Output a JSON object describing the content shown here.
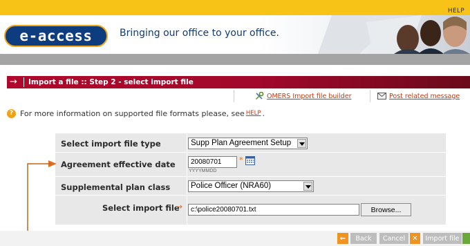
{
  "header": {
    "help_label": "HELP",
    "logo_text": "e-access",
    "tagline": "Bringing our office to your office."
  },
  "section": {
    "arrow": "→",
    "title": "Import a file :: Step 2 - select import file"
  },
  "links": {
    "builder": "OMERS Import file builder",
    "post_message": "Post related message"
  },
  "info": {
    "prefix": "For more information on supported file formats please, see",
    "help_link": "HELP",
    "suffix": "."
  },
  "form": {
    "import_type_label": "Select import file type",
    "import_type_value": "Supp Plan Agreement Setup",
    "date_label": "Agreement effective date",
    "date_value": "20080701",
    "required_mark": "*",
    "date_hint": "YYYYMMDD",
    "plan_class_label": "Supplemental plan class",
    "plan_class_value": "Police Officer (NRA60)",
    "file_label": "Select import file",
    "file_arrow": "→",
    "file_value": "c:\\police20080701.txt",
    "browse_label": "Browse..."
  },
  "footer": {
    "back_icon": "←",
    "back_label": "Back",
    "cancel_label": "Cancel",
    "cancel_icon": "✕",
    "import_label": "Import file"
  },
  "colors": {
    "top_bar": "#f7c316",
    "logo_bg": "#0d3d7e",
    "section_bar": "#b0082c",
    "link": "#c03a13",
    "annotation_arrow": "#e07020"
  }
}
